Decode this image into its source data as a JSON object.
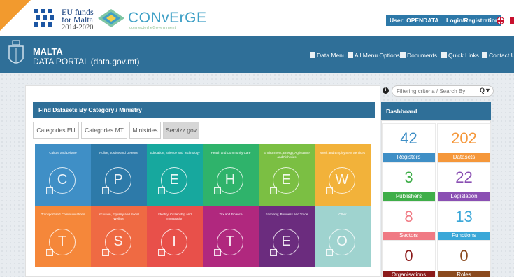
{
  "header": {
    "eu_line1": "EU funds",
    "eu_line2": "for Malta",
    "eu_line3": "2014-2020",
    "converge_title": "CONvErGE",
    "converge_subtitle": "connected eGovernment",
    "user_label": "User: OPENDATA",
    "login_label": "Login/Registration"
  },
  "navbar": {
    "brand_line1": "MALTA",
    "brand_line2": "DATA PORTAL (data.gov.mt)",
    "items": [
      {
        "label": "Data Menu",
        "icon": "file-icon"
      },
      {
        "label": "All Menu Options",
        "icon": "list-icon"
      },
      {
        "label": "Documents",
        "icon": "file-icon"
      },
      {
        "label": "Quick Links",
        "icon": "link-icon"
      },
      {
        "label": "Contact U",
        "icon": "chat-icon"
      }
    ]
  },
  "finder": {
    "title": "Find Datasets By Category / Ministry",
    "tabs": [
      "Categories EU",
      "Categories MT",
      "Ministries",
      "Servizz.gov"
    ],
    "tiles": [
      {
        "label": "Culture and Leisure",
        "letter": "C",
        "color": "#3f8fc6"
      },
      {
        "label": "Police, Justice and Defence",
        "letter": "P",
        "color": "#2d7aa9"
      },
      {
        "label": "Education, Science and Technology",
        "letter": "E",
        "color": "#17a89e"
      },
      {
        "label": "Health and Community Care",
        "letter": "H",
        "color": "#2fb36b"
      },
      {
        "label": "Environment, Energy, Agriculture and Fisheries",
        "letter": "E",
        "color": "#7bbf43"
      },
      {
        "label": "Work and Employment Services",
        "letter": "W",
        "color": "#f2b23a"
      },
      {
        "label": "Transport and Communications",
        "letter": "T",
        "color": "#f5873a"
      },
      {
        "label": "Inclusion, Equality and Social Welfare",
        "letter": "S",
        "color": "#ef6a43"
      },
      {
        "label": "Identity, Citizenship and Immigration",
        "letter": "I",
        "color": "#e8504a"
      },
      {
        "label": "Tax and Finance",
        "letter": "T",
        "color": "#b0287e"
      },
      {
        "label": "Economy, Business and Trade",
        "letter": "E",
        "color": "#6b2c7e"
      },
      {
        "label": "Other",
        "letter": "O",
        "color": "#9fd3cf"
      }
    ]
  },
  "search": {
    "placeholder": "Filtering criteria / Search By"
  },
  "dashboard": {
    "title": "Dashboard",
    "stats": [
      {
        "value": "42",
        "label": "Registers",
        "color": "#3f8fc6"
      },
      {
        "value": "202",
        "label": "Datasets",
        "color": "#f5973a"
      },
      {
        "value": "3",
        "label": "Publishers",
        "color": "#3fae49"
      },
      {
        "value": "22",
        "label": "Legislation",
        "color": "#8a4fb3"
      },
      {
        "value": "8",
        "label": "Sectors",
        "color": "#f07a84"
      },
      {
        "value": "13",
        "label": "Functions",
        "color": "#3aa7d8"
      },
      {
        "value": "0",
        "label": "Organisations",
        "color": "#8b1a1a"
      },
      {
        "value": "0",
        "label": "Roles",
        "color": "#8a4a1e"
      }
    ]
  }
}
